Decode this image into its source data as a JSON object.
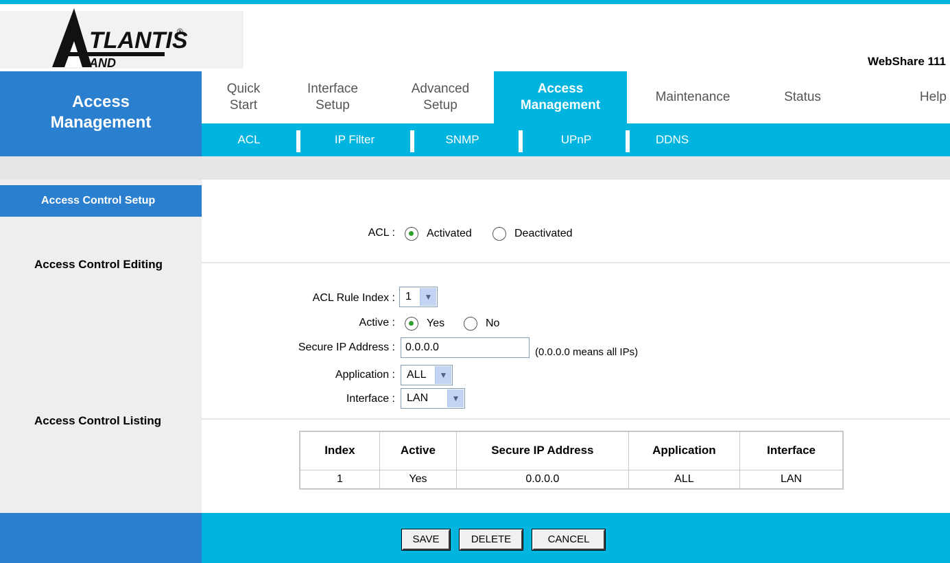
{
  "brand": {
    "model": "WebShare 111",
    "logo_text": "ATLANTIS",
    "logo_sub": "AND"
  },
  "section_title": "Access Management",
  "tabs": [
    {
      "label": "Quick Start",
      "active": false
    },
    {
      "label": "Interface Setup",
      "active": false
    },
    {
      "label": "Advanced Setup",
      "active": false
    },
    {
      "label": "Access Management",
      "active": true
    },
    {
      "label": "Maintenance",
      "active": false
    },
    {
      "label": "Status",
      "active": false
    },
    {
      "label": "Help",
      "active": false
    }
  ],
  "subnav": [
    "ACL",
    "IP Filter",
    "SNMP",
    "UPnP",
    "DDNS"
  ],
  "left": {
    "active": "Access Control Setup",
    "editing": "Access Control Editing",
    "listing": "Access Control Listing"
  },
  "acl": {
    "label": "ACL :",
    "opt1": "Activated",
    "opt2": "Deactivated",
    "selected": "Activated"
  },
  "form": {
    "rule_index_label": "ACL Rule Index :",
    "rule_index_value": "1",
    "active_label": "Active :",
    "active_yes": "Yes",
    "active_no": "No",
    "secure_ip_label": "Secure IP Address :",
    "secure_ip_value": "0.0.0.0",
    "secure_ip_note": "(0.0.0.0 means all IPs)",
    "application_label": "Application :",
    "application_value": "ALL",
    "interface_label": "Interface :",
    "interface_value": "LAN"
  },
  "table": {
    "headers": [
      "Index",
      "Active",
      "Secure IP Address",
      "Application",
      "Interface"
    ],
    "rows": [
      [
        "1",
        "Yes",
        "0.0.0.0",
        "ALL",
        "LAN"
      ]
    ]
  },
  "buttons": {
    "save": "SAVE",
    "delete": "DELETE",
    "cancel": "CANCEL"
  },
  "colors": {
    "accent": "#00b4e0",
    "section_blue": "#2a7fce"
  }
}
